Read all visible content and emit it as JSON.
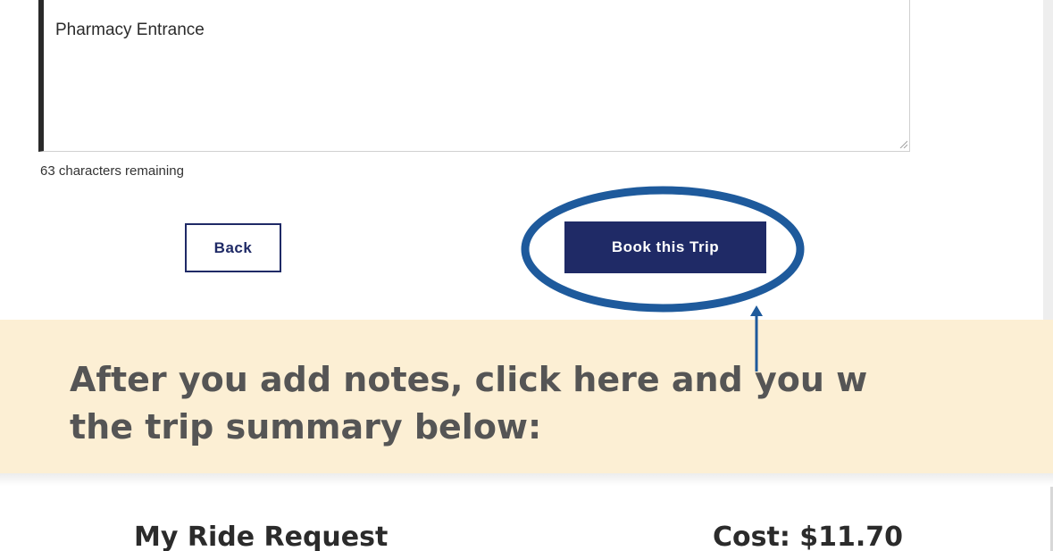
{
  "notes": {
    "value": "Pharmacy Entrance",
    "chars_remaining": "63 characters remaining"
  },
  "actions": {
    "back_label": "Back",
    "book_label": "Book this Trip"
  },
  "callout": {
    "line1": "After you add notes, click here and you w",
    "line2": "the trip summary below:"
  },
  "summary": {
    "title": "My Ride Request",
    "cost": "Cost: $11.70"
  },
  "colors": {
    "navy": "#1f2a66",
    "highlight": "#1e5a9c",
    "callout_bg": "#fcefd4",
    "callout_text": "#555555"
  }
}
